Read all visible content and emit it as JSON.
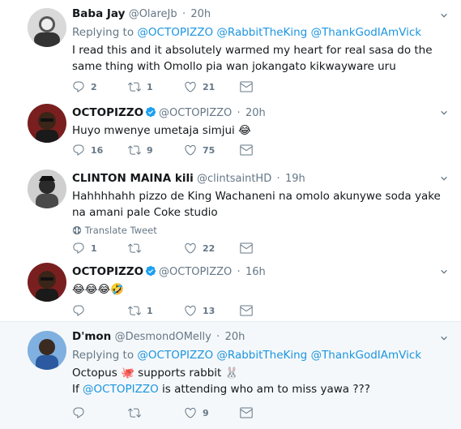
{
  "colors": {
    "accent": "#1b95e0",
    "muted": "#657786",
    "text": "#14171a",
    "highlight_bg": "#f5f8fa",
    "divider": "#e6ecf0"
  },
  "tweets": [
    {
      "name": "Baba Jay",
      "handle": "@OlareJb",
      "dot": "·",
      "time": "20h",
      "replying_prefix": "Replying to",
      "replying_to": [
        "@OCTOPIZZO",
        "@RabbitTheKing",
        "@ThankGodIAmVick"
      ],
      "text": "I read this and it absolutely warmed my heart for real sasa do the same thing with Omollo pia wan jokangato kikwayware uru",
      "replies": "2",
      "retweets": "1",
      "likes": "21"
    },
    {
      "name": "OCTOPIZZO",
      "verified": true,
      "handle": "@OCTOPIZZO",
      "dot": "·",
      "time": "20h",
      "text": "Huyo mwenye umetaja simjui 😂",
      "replies": "16",
      "retweets": "9",
      "likes": "75"
    },
    {
      "name": "CLINTON MAINA kili",
      "handle": "@clintsaintHD",
      "dot": "·",
      "time": "19h",
      "text": "Hahhhhahh pizzo de King Wachaneni na omolo akunywe soda yake na amani pale Coke studio",
      "translate": "Translate Tweet",
      "replies": "1",
      "retweets": "",
      "likes": "22"
    },
    {
      "name": "OCTOPIZZO",
      "verified": true,
      "handle": "@OCTOPIZZO",
      "dot": "·",
      "time": "16h",
      "text": "😂😂😂🤣",
      "replies": "",
      "retweets": "1",
      "likes": "13"
    },
    {
      "name": "D'mon",
      "handle": "@DesmondOMelly",
      "dot": "·",
      "time": "20h",
      "replying_prefix": "Replying to",
      "replying_to": [
        "@OCTOPIZZO",
        "@RabbitTheKing",
        "@ThankGodIAmVick"
      ],
      "line1_a": "Octopus ",
      "line1_emoji1": "🐙",
      "line1_b": " supports rabbit ",
      "line1_emoji2": "🐰",
      "line2_a": "If ",
      "line2_mention": "@OCTOPIZZO",
      "line2_b": " is attending who am to miss yawa ???",
      "replies": "",
      "retweets": "",
      "likes": "9"
    }
  ]
}
